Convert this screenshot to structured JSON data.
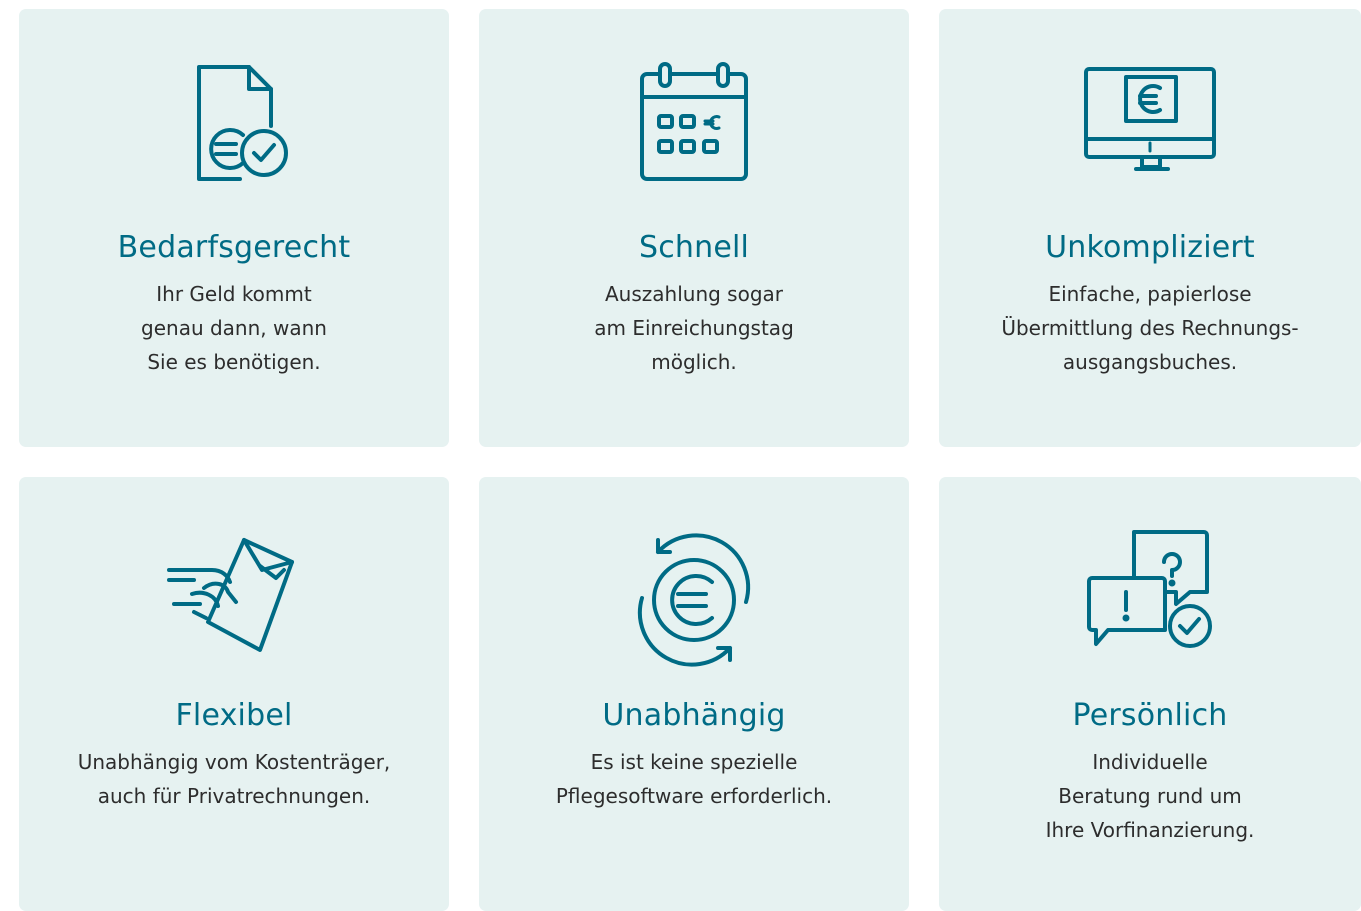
{
  "colors": {
    "card_background": "#e6f2f1",
    "accent": "#006b85",
    "text": "#2d2d2d"
  },
  "cards": [
    {
      "icon": "invoice-euro-check-icon",
      "title": "Bedarfsgerecht",
      "lines": [
        "Ihr Geld kommt",
        "genau dann, wann",
        "Sie es benötigen."
      ]
    },
    {
      "icon": "calendar-euro-icon",
      "title": "Schnell",
      "lines": [
        "Auszahlung sogar",
        "am Einreichungstag",
        "möglich."
      ]
    },
    {
      "icon": "monitor-euro-icon",
      "title": "Unkompliziert",
      "lines": [
        "Einfache, papierlose",
        "Übermittlung des Rechnungs-",
        "ausgangsbuches."
      ]
    },
    {
      "icon": "hand-envelope-icon",
      "title": "Flexibel",
      "lines": [
        "Unabhängig vom Kostenträger,",
        "auch für Privatrechnungen."
      ]
    },
    {
      "icon": "euro-cycle-icon",
      "title": "Unabhängig",
      "lines": [
        "Es ist keine spezielle",
        "Pflegesoftware erforderlich."
      ]
    },
    {
      "icon": "speech-bubbles-check-icon",
      "title": "Persönlich",
      "lines": [
        "Individuelle",
        "Beratung rund um",
        "Ihre Vorfinanzierung."
      ]
    }
  ]
}
